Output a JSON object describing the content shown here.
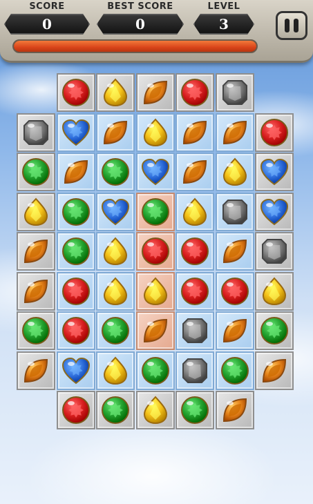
{
  "hud": {
    "score_label": "SCORE",
    "score_value": "0",
    "best_label": "BEST SCORE",
    "best_value": "0",
    "level_label": "LEVEL",
    "level_value": "3",
    "progress_fraction": 1.0
  },
  "colors": {
    "red": "#d81f1f",
    "yellow": "#f5c21a",
    "orange": "#e6851c",
    "gray": "#7e7e7e",
    "blue": "#2f6fdc",
    "green": "#22a12e"
  },
  "board": {
    "rows": [
      [
        "",
        "red",
        "yellow",
        "orange",
        "red",
        "gray",
        ""
      ],
      [
        "gray",
        "blue",
        "orange",
        "yellow",
        "orange",
        "orange",
        "red"
      ],
      [
        "green",
        "orange",
        "green",
        "blue",
        "orange",
        "yellow",
        "blue"
      ],
      [
        "yellow",
        "green",
        "blue",
        "green",
        "yellow",
        "gray",
        "blue"
      ],
      [
        "orange",
        "green",
        "yellow",
        "red",
        "red",
        "orange",
        "gray"
      ],
      [
        "orange",
        "red",
        "yellow",
        "yellow",
        "red",
        "red",
        "yellow"
      ],
      [
        "green",
        "red",
        "green",
        "orange",
        "gray",
        "orange",
        "green"
      ],
      [
        "orange",
        "blue",
        "yellow",
        "green",
        "gray",
        "green",
        "orange"
      ],
      [
        "",
        "red",
        "green",
        "yellow",
        "green",
        "orange",
        ""
      ]
    ],
    "tiles": [
      [
        "",
        "gray",
        "gray",
        "gray",
        "gray",
        "gray",
        ""
      ],
      [
        "gray",
        "blue",
        "blue",
        "blue",
        "blue",
        "blue",
        "gray"
      ],
      [
        "gray",
        "blue",
        "blue",
        "blue",
        "blue",
        "blue",
        "gray"
      ],
      [
        "gray",
        "blue",
        "blue",
        "peach",
        "blue",
        "blue",
        "gray"
      ],
      [
        "gray",
        "blue",
        "blue",
        "peach",
        "blue",
        "blue",
        "gray"
      ],
      [
        "gray",
        "blue",
        "blue",
        "peach",
        "blue",
        "blue",
        "gray"
      ],
      [
        "gray",
        "blue",
        "blue",
        "peach",
        "blue",
        "blue",
        "gray"
      ],
      [
        "gray",
        "blue",
        "blue",
        "blue",
        "blue",
        "blue",
        "gray"
      ],
      [
        "",
        "gray",
        "gray",
        "gray",
        "gray",
        "gray",
        ""
      ]
    ]
  }
}
